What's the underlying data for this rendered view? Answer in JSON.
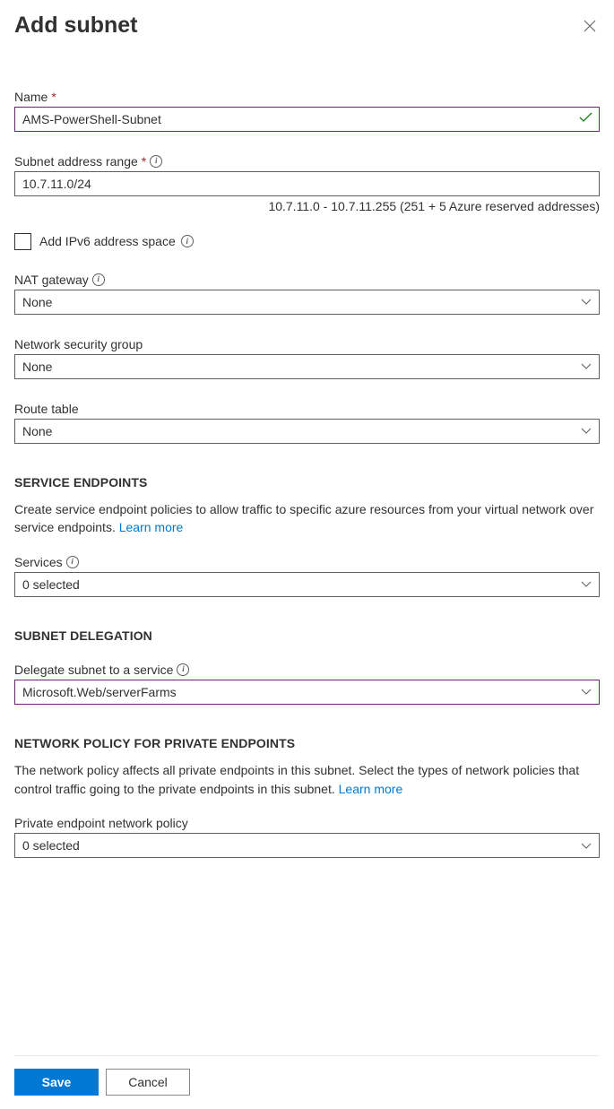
{
  "header": {
    "title": "Add subnet"
  },
  "fields": {
    "name": {
      "label": "Name",
      "value": "AMS-PowerShell-Subnet"
    },
    "subnet_range": {
      "label": "Subnet address range",
      "value": "10.7.11.0/24",
      "hint": "10.7.11.0 - 10.7.11.255 (251 + 5 Azure reserved addresses)"
    },
    "ipv6_checkbox": {
      "label": "Add IPv6 address space",
      "checked": false
    },
    "nat_gateway": {
      "label": "NAT gateway",
      "value": "None"
    },
    "nsg": {
      "label": "Network security group",
      "value": "None"
    },
    "route_table": {
      "label": "Route table",
      "value": "None"
    }
  },
  "service_endpoints": {
    "header": "SERVICE ENDPOINTS",
    "description": "Create service endpoint policies to allow traffic to specific azure resources from your virtual network over service endpoints. ",
    "learn_more": "Learn more",
    "services_label": "Services",
    "services_value": "0 selected"
  },
  "subnet_delegation": {
    "header": "SUBNET DELEGATION",
    "label": "Delegate subnet to a service",
    "value": "Microsoft.Web/serverFarms"
  },
  "network_policy": {
    "header": "NETWORK POLICY FOR PRIVATE ENDPOINTS",
    "description": "The network policy affects all private endpoints in this subnet. Select the types of network policies that control traffic going to the private endpoints in this subnet. ",
    "learn_more": "Learn more",
    "label": "Private endpoint network policy",
    "value": "0 selected"
  },
  "footer": {
    "save": "Save",
    "cancel": "Cancel"
  }
}
